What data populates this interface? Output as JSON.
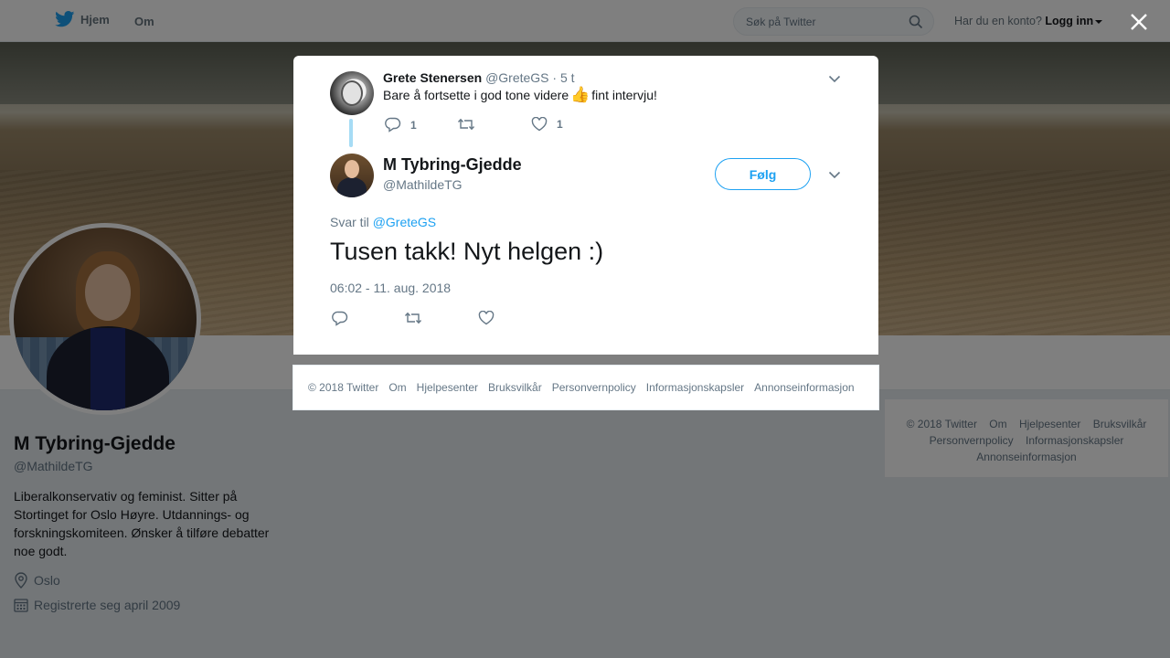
{
  "nav": {
    "home_label": "Hjem",
    "about_label": "Om",
    "search_placeholder": "Søk på Twitter",
    "login_prompt": "Har du en konto?",
    "login_label": "Logg inn"
  },
  "profile": {
    "name": "M Tybring-Gjedde",
    "handle": "@MathildeTG",
    "bio": "Liberalkonservativ og feminist. Sitter på Stortinget for Oslo Høyre. Utdannings- og forskningskomiteen. Ønsker å tilføre debatter noe godt.",
    "location": "Oslo",
    "joined": "Registrerte seg april 2009"
  },
  "right_footer": {
    "copyright": "© 2018 Twitter",
    "about": "Om",
    "help": "Hjelpesenter",
    "terms": "Bruksvilkår",
    "privacy": "Personvernpolicy",
    "cookies": "Informasjonskapsler",
    "ads": "Annonseinformasjon"
  },
  "modal": {
    "parent_tweet": {
      "author_name": "Grete Stenersen",
      "author_handle": "@GreteGS",
      "time": "· 5 t",
      "text": "Bare å fortsette i god tone videre",
      "emoji": "👍",
      "text_after": "fint intervju!",
      "reply_count": "1",
      "like_count": "1"
    },
    "main_tweet": {
      "author_name": "M Tybring-Gjedde",
      "author_handle": "@MathildeTG",
      "follow_label": "Følg",
      "reply_prefix": "Svar til",
      "reply_to": "@GreteGS",
      "text": "Tusen takk! Nyt helgen :)",
      "timestamp": "06:02 - 11. aug. 2018"
    }
  },
  "modal_footer": {
    "copyright": "© 2018 Twitter",
    "about": "Om",
    "help": "Hjelpesenter",
    "terms": "Bruksvilkår",
    "privacy": "Personvernpolicy",
    "cookies": "Informasjonskapsler",
    "ads": "Annonseinformasjon"
  },
  "colors": {
    "accent": "#1da1f2",
    "thread_line": "#a6dcf5",
    "muted": "#657786",
    "overlay": "rgba(0,0,0,0.5)"
  }
}
